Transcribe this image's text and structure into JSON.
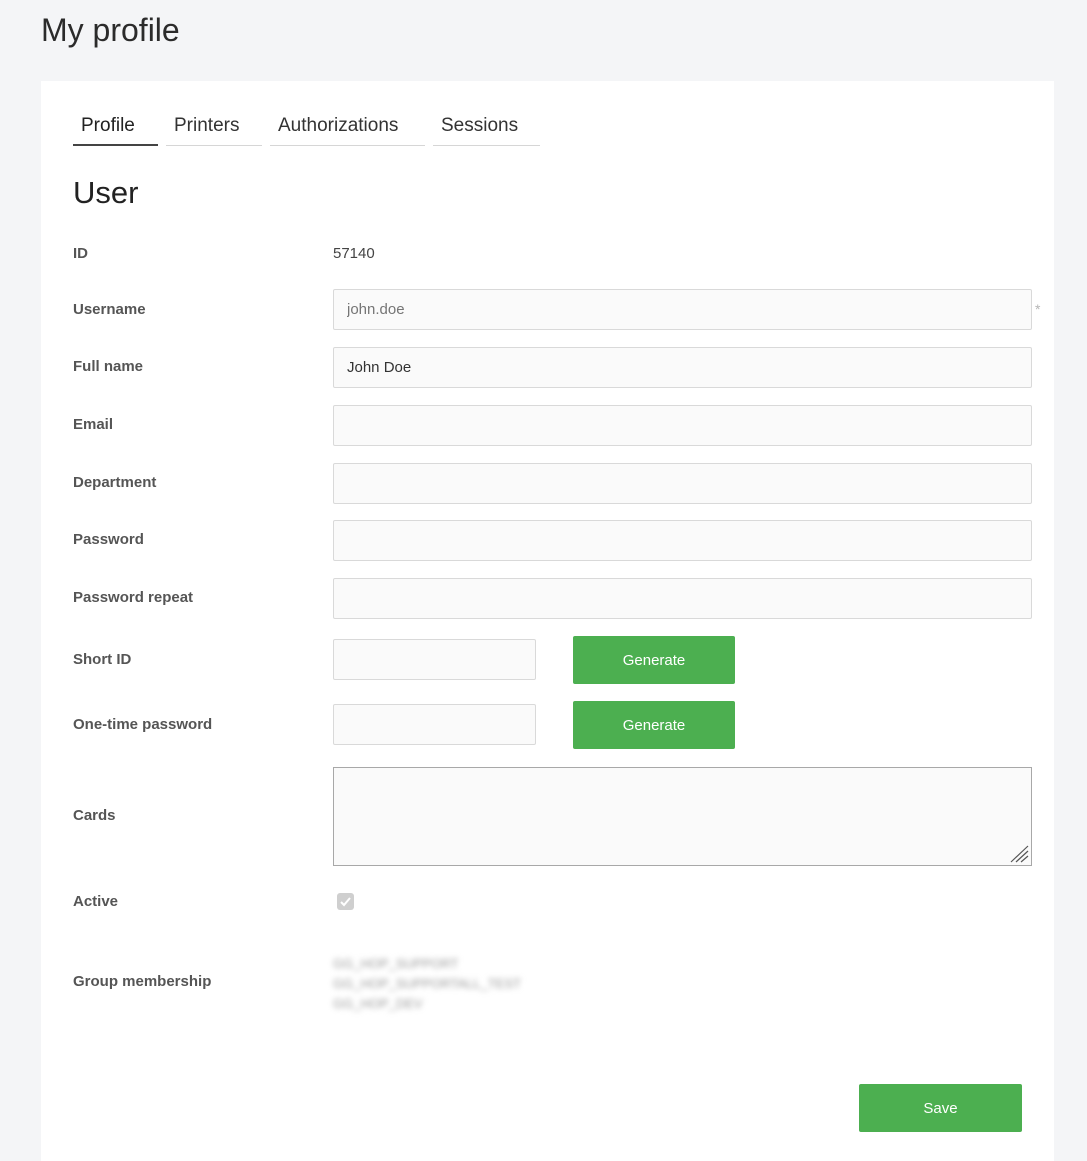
{
  "page": {
    "title": "My profile"
  },
  "tabs": [
    {
      "label": "Profile",
      "active": true
    },
    {
      "label": "Printers",
      "active": false
    },
    {
      "label": "Authorizations",
      "active": false
    },
    {
      "label": "Sessions",
      "active": false
    }
  ],
  "section": {
    "title": "User"
  },
  "fields": {
    "id": {
      "label": "ID",
      "value": "57140"
    },
    "username": {
      "label": "Username",
      "placeholder": "john.doe",
      "required_mark": "*"
    },
    "full_name": {
      "label": "Full name",
      "value": "John Doe"
    },
    "email": {
      "label": "Email",
      "value": ""
    },
    "department": {
      "label": "Department",
      "value": ""
    },
    "password": {
      "label": "Password",
      "value": ""
    },
    "password_repeat": {
      "label": "Password repeat",
      "value": ""
    },
    "short_id": {
      "label": "Short ID",
      "value": "",
      "button_label": "Generate"
    },
    "one_time_password": {
      "label": "One-time password",
      "value": "",
      "button_label": "Generate"
    },
    "cards": {
      "label": "Cards",
      "value": ""
    },
    "active": {
      "label": "Active",
      "checked": true
    },
    "group_membership": {
      "label": "Group membership",
      "groups": [
        "GG_HOP_SUPPORT",
        "GG_HOP_SUPPORTALL_TEST",
        "GG_HOP_DEV"
      ]
    }
  },
  "actions": {
    "save_label": "Save"
  },
  "colors": {
    "accent_green": "#4caf50",
    "background": "#f4f5f7",
    "card": "#ffffff"
  }
}
